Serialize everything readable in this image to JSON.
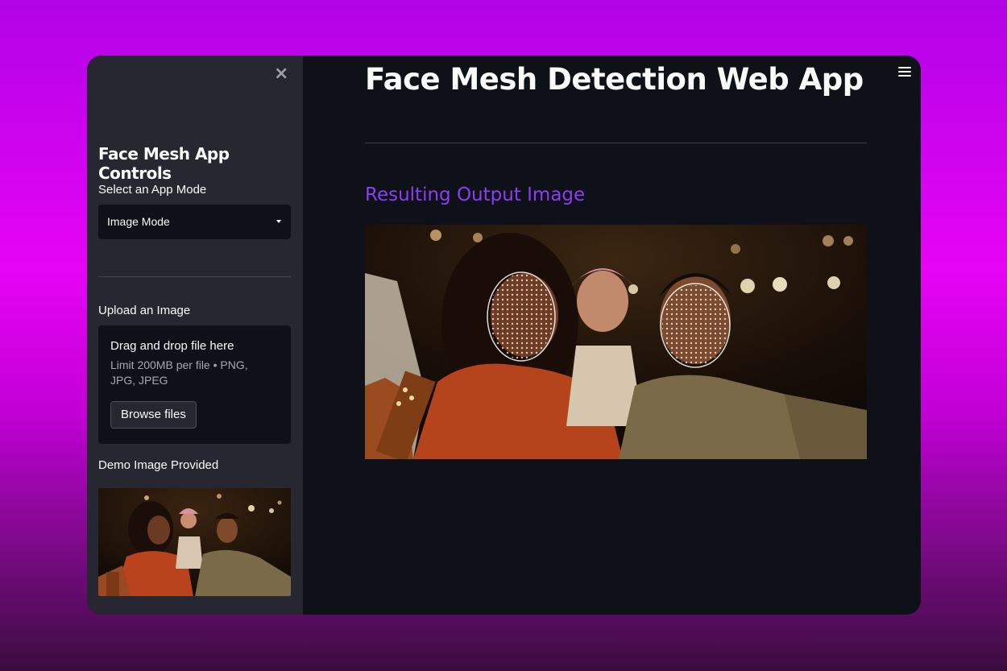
{
  "sidebar": {
    "close_label": "×",
    "title": "Face Mesh App Controls",
    "mode_label": "Select an App Mode",
    "mode_selected": "Image Mode",
    "upload_label": "Upload an Image",
    "dropzone": {
      "title": "Drag and drop file here",
      "limit": "Limit 200MB per file • PNG, JPG, JPEG",
      "browse_label": "Browse files"
    },
    "demo_label": "Demo Image Provided"
  },
  "main": {
    "title": "Face Mesh Detection Web App",
    "section_title": "Resulting Output Image"
  },
  "colors": {
    "accent": "#8a3ff3",
    "sidebar_bg": "#262730",
    "main_bg": "#0e1117"
  }
}
